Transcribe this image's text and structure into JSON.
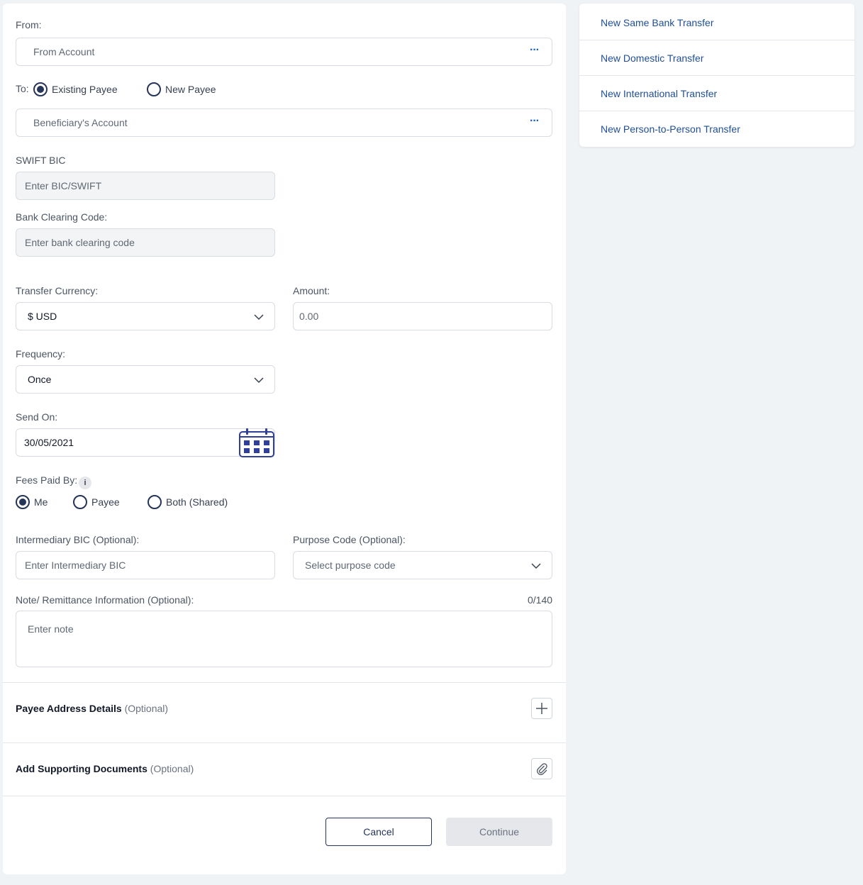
{
  "form": {
    "from_label": "From:",
    "from_placeholder": "From Account",
    "to_label": "To:",
    "to_options": [
      "Existing Payee",
      "New Payee"
    ],
    "beneficiary_placeholder": "Beneficiary's Account",
    "swift_label": "SWIFT BIC",
    "swift_placeholder": "Enter BIC/SWIFT",
    "clearing_label": "Bank Clearing Code:",
    "clearing_placeholder": "Enter bank clearing code",
    "currency_label": "Transfer Currency:",
    "currency_value": "$ USD",
    "amount_label": "Amount:",
    "amount_placeholder": "0.00",
    "frequency_label": "Frequency:",
    "frequency_value": "Once",
    "send_on_label": "Send On:",
    "send_on_value": "30/05/2021",
    "fees_label": "Fees Paid By:",
    "fees_options": [
      "Me",
      "Payee",
      "Both (Shared)"
    ],
    "intermediary_label": "Intermediary BIC (Optional):",
    "intermediary_placeholder": "Enter Intermediary BIC",
    "purpose_label": "Purpose Code (Optional):",
    "purpose_placeholder": "Select purpose code",
    "note_label": "Note/ Remittance Information (Optional):",
    "note_counter": "0/140",
    "note_placeholder": "Enter note"
  },
  "sections": {
    "payee_address_title": "Payee Address Details",
    "payee_address_opt": "(Optional)",
    "docs_title": "Add Supporting Documents",
    "docs_opt": "(Optional)"
  },
  "actions": {
    "cancel_label": "Cancel",
    "continue_label": "Continue"
  },
  "sidebar": {
    "items": [
      {
        "label": "New Same Bank Transfer"
      },
      {
        "label": "New Domestic Transfer"
      },
      {
        "label": "New International Transfer"
      },
      {
        "label": "New Person-to-Person Transfer"
      }
    ]
  },
  "colors": {
    "accent": "#26345a",
    "link": "#1f4e97",
    "calendar": "#2f3f9a"
  }
}
